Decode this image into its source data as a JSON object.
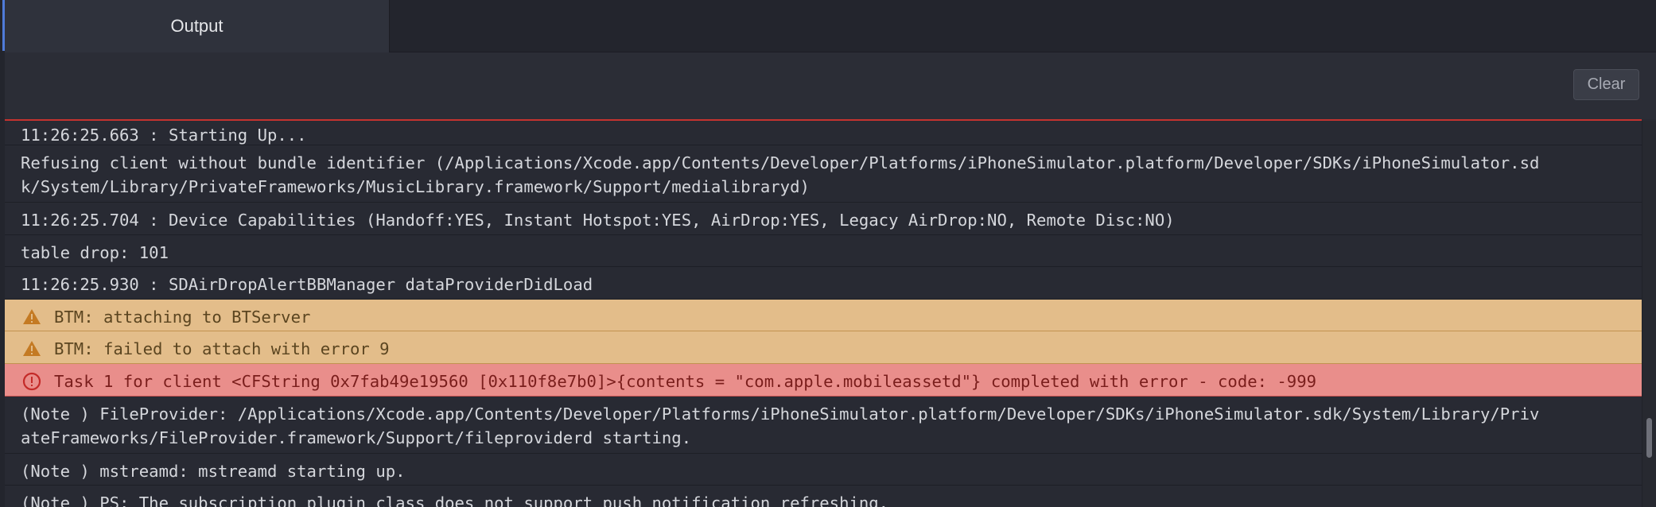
{
  "tabs": {
    "output_label": "Output"
  },
  "toolbar": {
    "clear_label": "Clear"
  },
  "log": [
    {
      "level": "info",
      "text": "11:26:25.663 : Starting Up..."
    },
    {
      "level": "info",
      "lines": [
        "Refusing client without bundle identifier (/Applications/Xcode.app/Contents/Developer/Platforms/iPhoneSimulator.platform/Developer/SDKs/iPhoneSimulator.sd",
        "k/System/Library/PrivateFrameworks/MusicLibrary.framework/Support/medialibraryd)"
      ]
    },
    {
      "level": "info",
      "text": "11:26:25.704 : Device Capabilities (Handoff:YES, Instant Hotspot:YES, AirDrop:YES, Legacy AirDrop:NO, Remote Disc:NO)"
    },
    {
      "level": "info",
      "text": "table drop: 101"
    },
    {
      "level": "info",
      "text": "11:26:25.930 : SDAirDropAlertBBManager dataProviderDidLoad"
    },
    {
      "level": "warning",
      "icon": "warning-icon",
      "text": "BTM: attaching to BTServer"
    },
    {
      "level": "warning",
      "icon": "warning-icon",
      "text": "BTM: failed to attach with error 9"
    },
    {
      "level": "error",
      "icon": "error-icon",
      "text": "Task 1 for client <CFString 0x7fab49e19560 [0x110f8e7b0]>{contents = \"com.apple.mobileassetd\"} completed with error - code: -999"
    },
    {
      "level": "info",
      "lines": [
        "(Note ) FileProvider: /Applications/Xcode.app/Contents/Developer/Platforms/iPhoneSimulator.platform/Developer/SDKs/iPhoneSimulator.sdk/System/Library/Priv",
        "ateFrameworks/FileProvider.framework/Support/fileproviderd starting."
      ]
    },
    {
      "level": "info",
      "text": "(Note ) mstreamd: mstreamd starting up."
    },
    {
      "level": "info",
      "text": "(Note ) PS: The subscription plugin class does not support push notification refreshing."
    }
  ],
  "colors": {
    "accent": "#4f7bd9",
    "warning_bg": "#e3bd8a",
    "error_bg": "#e98e8b",
    "divider": "#c5332f"
  }
}
